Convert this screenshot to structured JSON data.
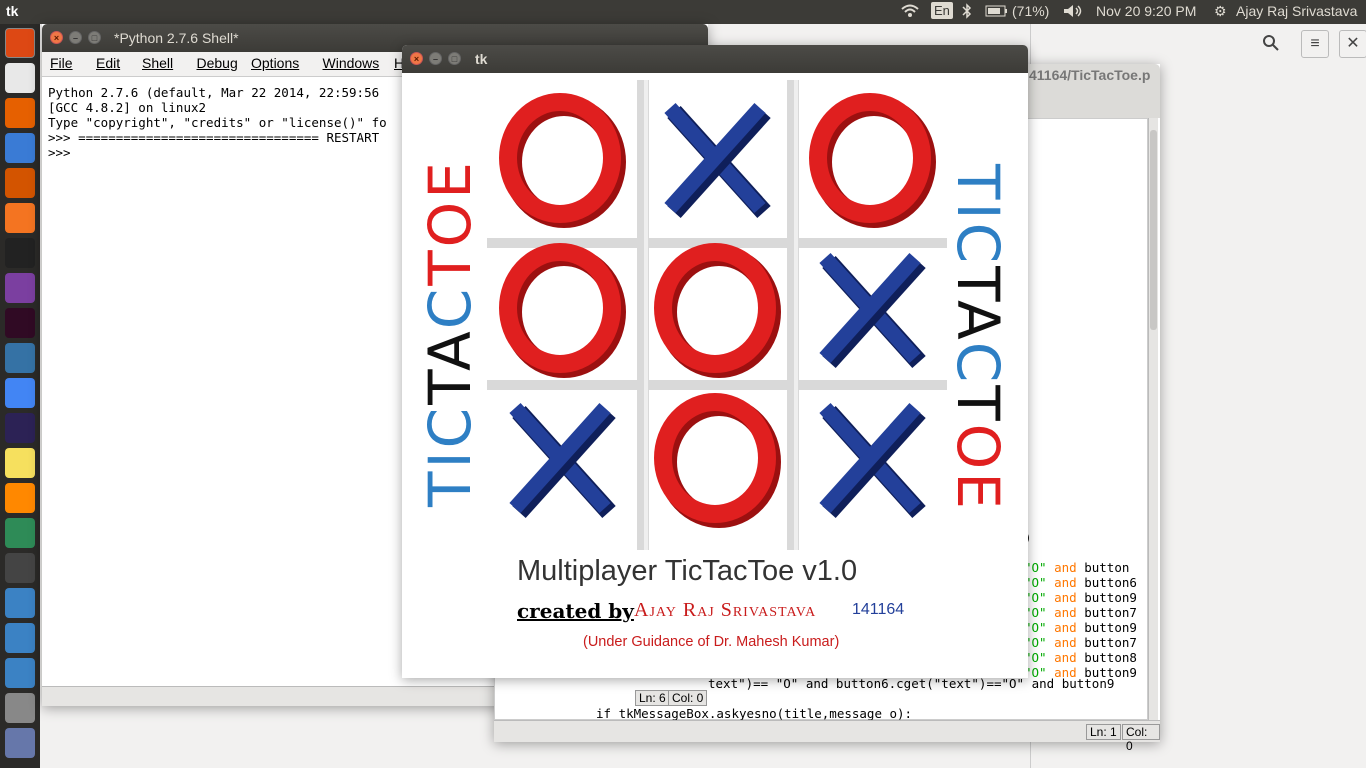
{
  "topbar": {
    "app_title": "tk",
    "keyboard": "En",
    "battery": "(71%)",
    "datetime": "Nov 20  9:20 PM",
    "user": "Ajay Raj Srivastava"
  },
  "launcher_icons": [
    "ubuntu-dash",
    "files",
    "firefox",
    "writer",
    "impress",
    "software-center",
    "amazon",
    "unity-tweak",
    "terminal",
    "python",
    "chromium",
    "eclipse",
    "sticky-notes",
    "vlc",
    "calc",
    "switch",
    "idle-1",
    "idle-2",
    "idle-3",
    "help",
    "usb"
  ],
  "shell": {
    "title": "*Python 2.7.6 Shell*",
    "menu": [
      "File",
      "Edit",
      "Shell",
      "Debug",
      "Options",
      "Windows",
      "Help"
    ],
    "lines": [
      "Python 2.7.6 (default, Mar 22 2014, 22:59:56",
      "[GCC 4.8.2] on linux2",
      "Type \"copyright\", \"credits\" or \"license()\" fo",
      ">>> ================================ RESTART",
      ">>> "
    ],
    "status_ln": "Ln: 6",
    "status_col": "Col: 0"
  },
  "editor": {
    "title": "41164/TicTacToe.p",
    "code_tail": [
      ")",
      "",
      "\"O\" and button",
      "\"O\" and button6",
      "\"O\" and button9",
      "\"O\" and button7",
      "\"O\" and button9",
      "\"O\" and button7",
      "\"O\" and button8",
      "\"O\" and button9"
    ],
    "line_a": "text\")== \"O\" and button6.cget(\"text\")==\"O\" and button9",
    "line_b": "if tkMessageBox.askyesno(title,message_o):",
    "status_ln": "Ln: 1",
    "status_col": "Col: 0"
  },
  "tk": {
    "title": "tk",
    "side_text": "TICTACTOE",
    "board": [
      "O",
      "X",
      "O",
      "O",
      "O",
      "X",
      "X",
      "O",
      "X"
    ],
    "heading": "Multiplayer TicTacToe v1.0",
    "created_by": "created by",
    "author": "Ajay Raj Srivastava",
    "roll": "141164",
    "guidance": "(Under Guidance of Dr. Mahesh Kumar)",
    "colors": {
      "o": "#e01f1f",
      "x": "#23409a",
      "blue": "#2e7fc4"
    }
  }
}
